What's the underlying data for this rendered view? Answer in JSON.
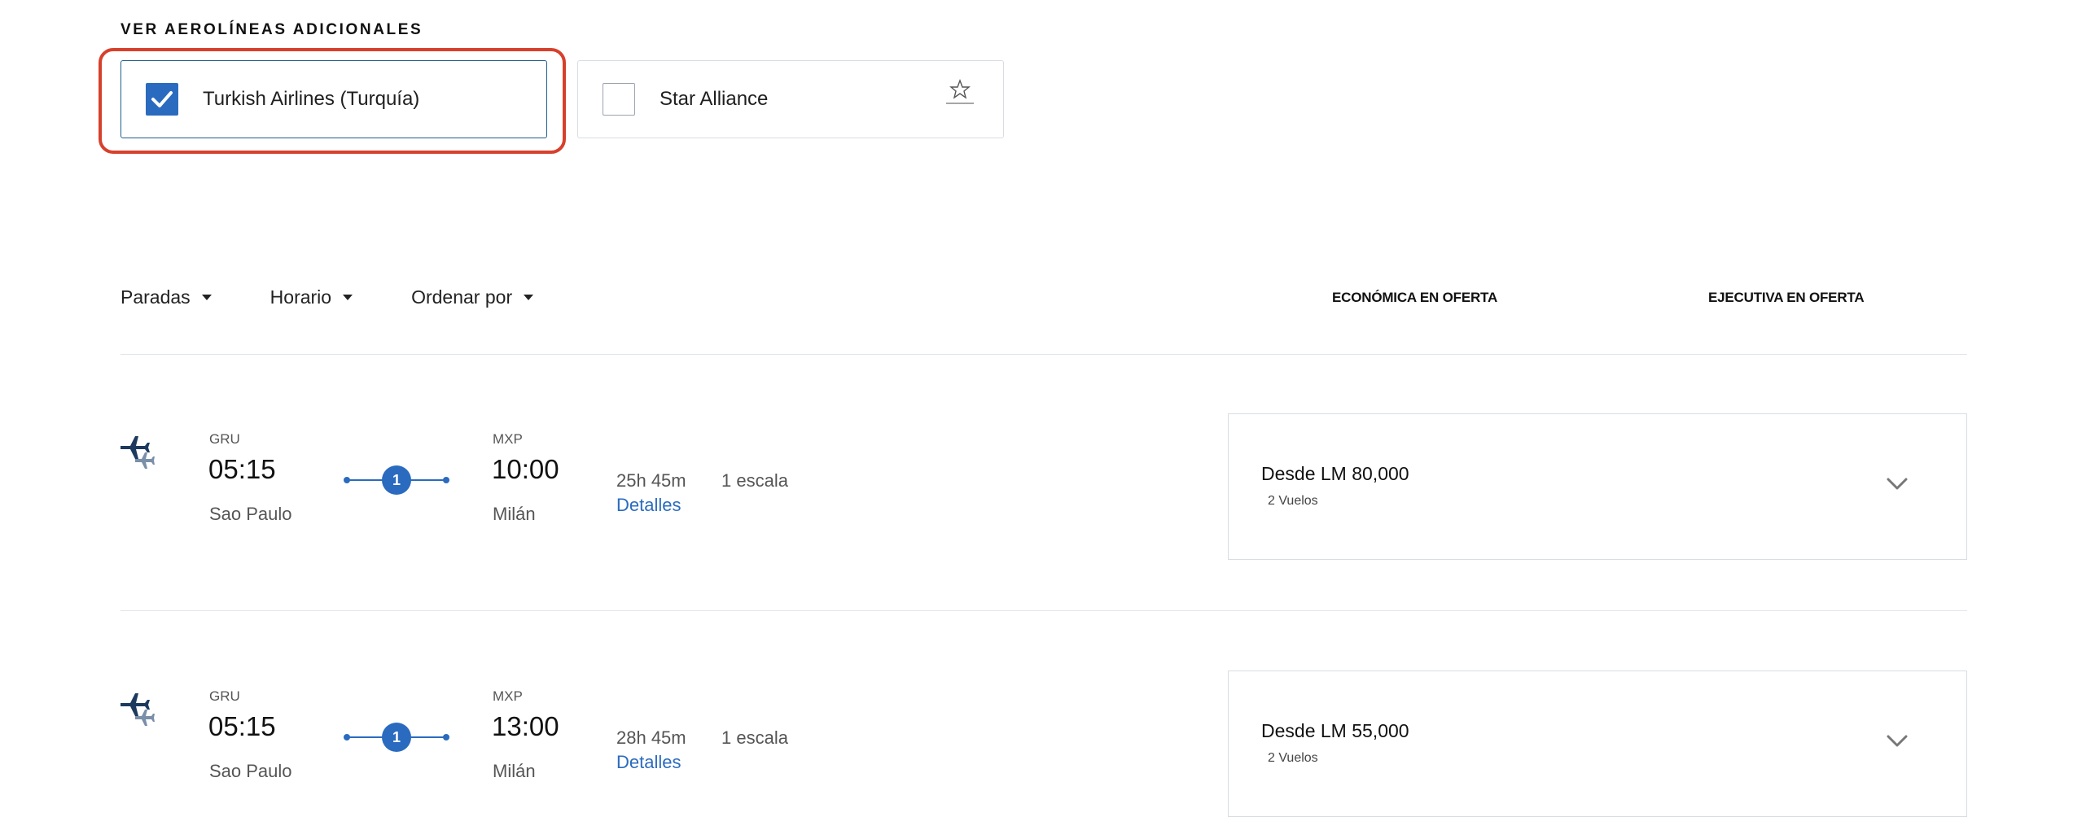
{
  "section_title": "VER AEROLÍNEAS ADICIONALES",
  "airlines": [
    {
      "name": "Turkish Airlines (Turquía)",
      "checked": true
    },
    {
      "name": "Star Alliance",
      "checked": false
    }
  ],
  "filters": [
    "Paradas",
    "Horario",
    "Ordenar por"
  ],
  "columns": {
    "economy": "ECONÓMICA EN OFERTA",
    "executive": "EJECUTIVA EN OFERTA"
  },
  "flights": [
    {
      "origin_code": "GRU",
      "depart_time": "05:15",
      "origin_city": "Sao Paulo",
      "stops_count": "1",
      "dest_code": "MXP",
      "arrive_time": "10:00",
      "dest_city": "Milán",
      "duration": "25h 45m",
      "details_label": "Detalles",
      "stops_label": "1 escala",
      "fare_price": "Desde LM 80,000",
      "fare_flights": "2 Vuelos"
    },
    {
      "origin_code": "GRU",
      "depart_time": "05:15",
      "origin_city": "Sao Paulo",
      "stops_count": "1",
      "dest_code": "MXP",
      "arrive_time": "13:00",
      "dest_city": "Milán",
      "duration": "28h 45m",
      "details_label": "Detalles",
      "stops_label": "1 escala",
      "fare_price": "Desde LM 55,000",
      "fare_flights": "2 Vuelos"
    }
  ],
  "colors": {
    "accent": "#2a6bbf",
    "highlight": "#d7402c",
    "selected_border": "#1f5e8c",
    "navy": "#1c3a5e"
  },
  "icons": {
    "plane": "airplane-icon",
    "check": "checkmark-icon",
    "caret": "caret-down-icon",
    "chevron": "chevron-down-icon",
    "logo": "star-alliance-logo"
  }
}
